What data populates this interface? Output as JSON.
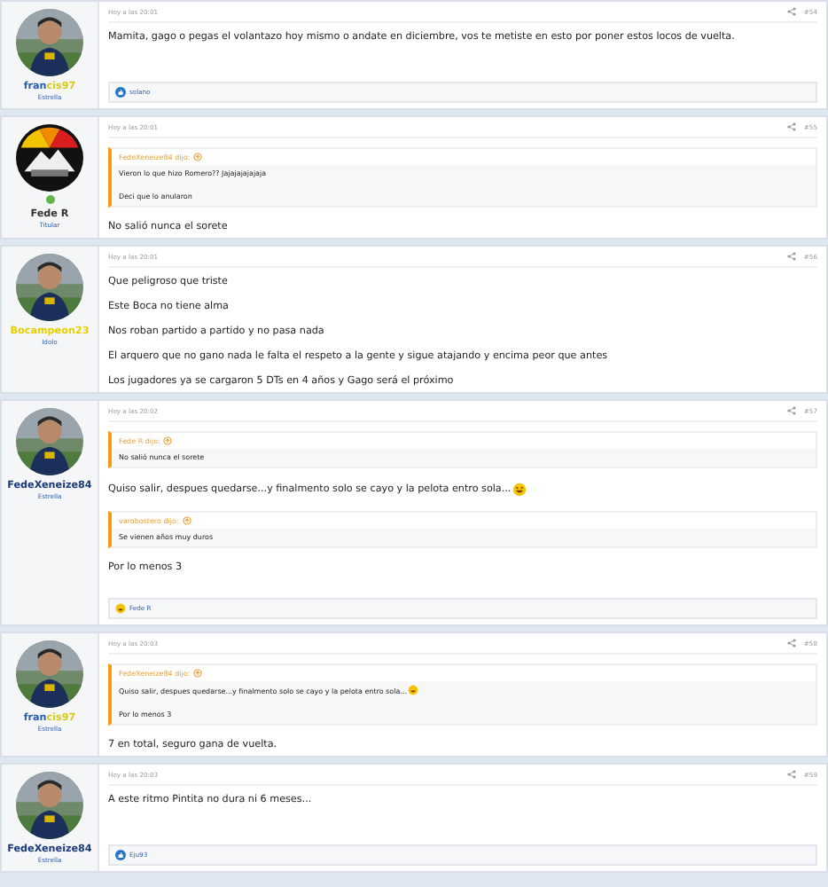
{
  "posts": [
    {
      "user": {
        "name_parts": [
          {
            "text": "fran",
            "color": "#2a5db0"
          },
          {
            "text": "cis97",
            "color": "#d8c81a"
          }
        ],
        "role": "Estrella",
        "online": false
      },
      "time": "Hoy a las 20:01",
      "number": "#54",
      "body": [
        {
          "kind": "text",
          "text": "Mamita, gago o pegas el volantazo hoy mismo o andate en diciembre, vos te metiste en esto por poner estos locos de vuelta."
        }
      ],
      "reaction": {
        "kind": "like",
        "name": "solano"
      }
    },
    {
      "user": {
        "name_parts": [
          {
            "text": "Fede R",
            "color": "#333333"
          }
        ],
        "role": "Titular",
        "avatar": {
          "kind": "logo"
        },
        "online": true
      },
      "time": "Hoy a las 20:01",
      "number": "#55",
      "body": [
        {
          "kind": "quote",
          "author": "FedeXeneize84 dijo:",
          "lines": [
            "Vieron lo que hizo Romero?? Jajajajajajaja",
            "Deci que lo anularon"
          ]
        },
        {
          "kind": "text",
          "text": "No salió nunca el sorete"
        }
      ]
    },
    {
      "user": {
        "name_parts": [
          {
            "text": "Bocampeon23",
            "color": "#e8d000"
          }
        ],
        "role": "Idolo",
        "online": false
      },
      "time": "Hoy a las 20:01",
      "number": "#56",
      "body": [
        {
          "kind": "text",
          "text": "Que peligroso que triste"
        },
        {
          "kind": "text",
          "text": "Este Boca no tiene alma"
        },
        {
          "kind": "text",
          "text": "Nos roban partido a partido y no pasa nada"
        },
        {
          "kind": "text",
          "text": "El arquero que no gano nada le falta el respeto a la gente y sigue atajando y encima peor que antes"
        },
        {
          "kind": "text",
          "text": "Los jugadores ya se cargaron 5 DTs en 4 años y Gago será el próximo"
        }
      ]
    },
    {
      "user": {
        "name_parts": [
          {
            "text": "FedeXeneize84",
            "color": "#1c3a78"
          }
        ],
        "role": "Estrella",
        "online": false
      },
      "time": "Hoy a las 20:02",
      "number": "#57",
      "body": [
        {
          "kind": "quote",
          "author": "Fede R dijo:",
          "lines": [
            "No salió nunca el sorete"
          ]
        },
        {
          "kind": "text",
          "text": "Quiso salir, despues quedarse...y finalmento solo se cayo y la pelota entro sola...",
          "emoji": true
        },
        {
          "kind": "quote",
          "author": "varobostero dijo:",
          "lines": [
            "Se vienen años muy duros"
          ]
        },
        {
          "kind": "text",
          "text": "Por lo menos 3"
        }
      ],
      "reaction": {
        "kind": "laugh",
        "name": "Fede R"
      }
    },
    {
      "user": {
        "name_parts": [
          {
            "text": "fran",
            "color": "#2a5db0"
          },
          {
            "text": "cis97",
            "color": "#d8c81a"
          }
        ],
        "role": "Estrella",
        "online": false
      },
      "time": "Hoy a las 20:03",
      "number": "#58",
      "body": [
        {
          "kind": "quote",
          "author": "FedeXeneize84 dijo:",
          "lines": [
            "Quiso salir, despues quedarse...y finalmento solo se cayo y la pelota entro sola...",
            "Por lo menos 3"
          ],
          "emoji": true
        },
        {
          "kind": "text",
          "text": "7 en total, seguro gana de vuelta."
        }
      ]
    },
    {
      "user": {
        "name_parts": [
          {
            "text": "FedeXeneize84",
            "color": "#1c3a78"
          }
        ],
        "role": "Estrella",
        "online": false
      },
      "time": "Hoy a las 20:03",
      "number": "#59",
      "body": [
        {
          "kind": "text",
          "text": "A este ritmo Pintita no dura ni 6 meses..."
        }
      ],
      "reaction": {
        "kind": "like",
        "name": "Eju93"
      }
    }
  ]
}
